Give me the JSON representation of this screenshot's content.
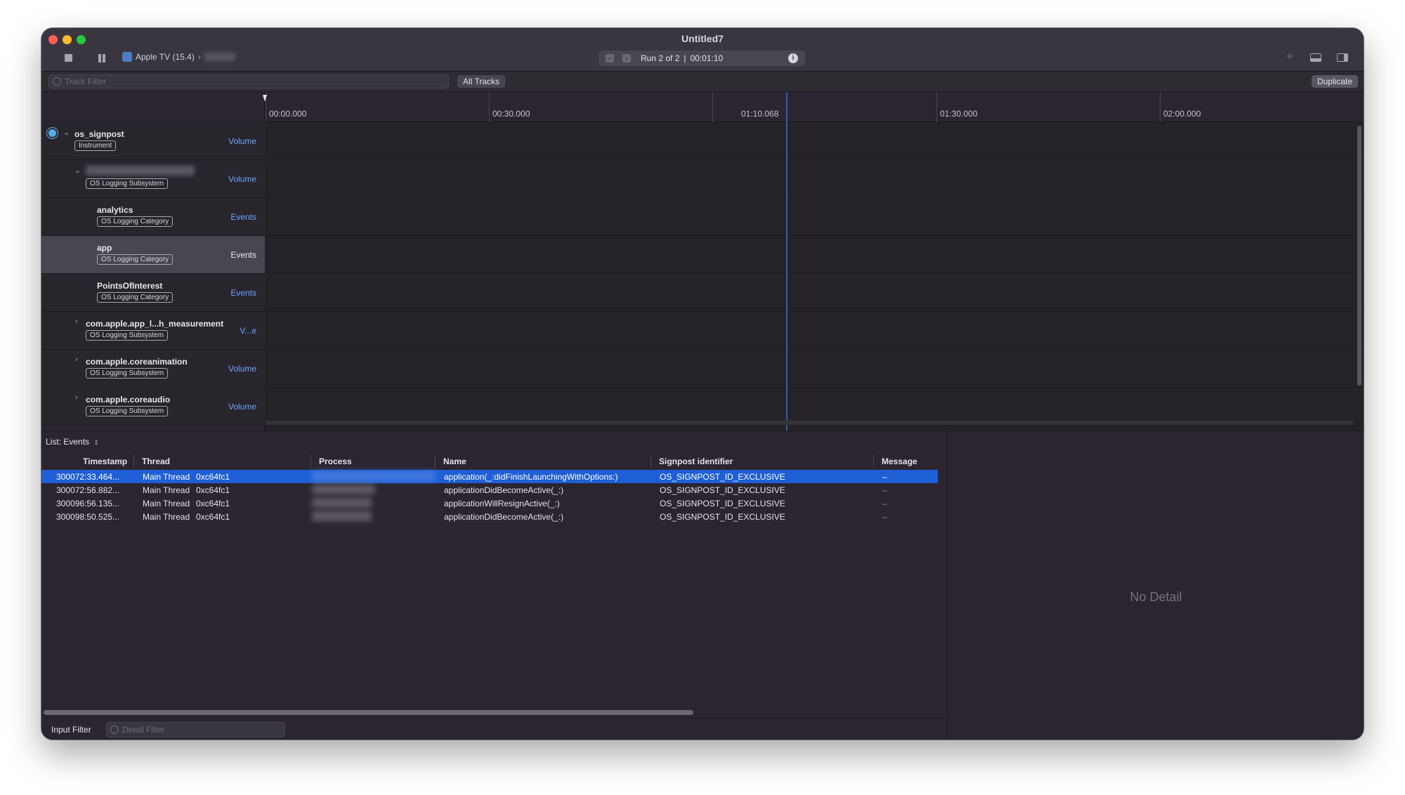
{
  "window": {
    "title": "Untitled7"
  },
  "toolbar": {
    "device": "Apple TV (15.4)",
    "run_label": "Run 2 of 2",
    "run_separator": "|",
    "run_time": "00:01:10",
    "info_glyph": "i",
    "plus_glyph": "+"
  },
  "filterbar": {
    "track_filter_placeholder": "Track Filter",
    "all_tracks": "All Tracks",
    "duplicate": "Duplicate"
  },
  "ruler": {
    "ticks": [
      "00:00.000",
      "00:30.000",
      "01:30.000",
      "02:00.000"
    ],
    "inspection_time": "01:10.068"
  },
  "tracks": [
    {
      "name": "os_signpost",
      "tag": "Instrument",
      "kind": "Volume",
      "expanded": true
    },
    {
      "name": "",
      "tag": "OS Logging Subsystem",
      "kind": "Volume",
      "expanded": true
    },
    {
      "name": "analytics",
      "tag": "OS Logging Category",
      "kind": "Events"
    },
    {
      "name": "app",
      "tag": "OS Logging Category",
      "kind": "Events",
      "selected": true
    },
    {
      "name": "PointsOfInterest",
      "tag": "OS Logging Category",
      "kind": "Events"
    },
    {
      "name": "com.apple.app_l...h_measurement",
      "tag": "OS Logging Subsystem",
      "kind": "V...e",
      "expanded": false
    },
    {
      "name": "com.apple.coreanimation",
      "tag": "OS Logging Subsystem",
      "kind": "Volume",
      "expanded": false
    },
    {
      "name": "com.apple.coreaudio",
      "tag": "OS Logging Subsystem",
      "kind": "Volume",
      "expanded": false
    }
  ],
  "list": {
    "mode_label": "List: Events",
    "columns": {
      "timestamp": "Timestamp",
      "thread": "Thread",
      "process": "Process",
      "name": "Name",
      "signpost_id": "Signpost identifier",
      "message": "Message"
    },
    "rows": [
      {
        "timestamp": "300072:33.464...",
        "thread": "Main Thread",
        "thread_id": "0xc64fc1",
        "name": "application(_:didFinishLaunchingWithOptions:)",
        "signpost_id": "OS_SIGNPOST_ID_EXCLUSIVE",
        "message": "–",
        "selected": true
      },
      {
        "timestamp": "300072:56.882...",
        "thread": "Main Thread",
        "thread_id": "0xc64fc1",
        "name": "applicationDidBecomeActive(_:)",
        "signpost_id": "OS_SIGNPOST_ID_EXCLUSIVE",
        "message": "–"
      },
      {
        "timestamp": "300096:56.135...",
        "thread": "Main Thread",
        "thread_id": "0xc64fc1",
        "name": "applicationWillResignActive(_:)",
        "signpost_id": "OS_SIGNPOST_ID_EXCLUSIVE",
        "message": "–"
      },
      {
        "timestamp": "300098:50.525...",
        "thread": "Main Thread",
        "thread_id": "0xc64fc1",
        "name": "applicationDidBecomeActive(_:)",
        "signpost_id": "OS_SIGNPOST_ID_EXCLUSIVE",
        "message": "–"
      }
    ],
    "input_filter": "Input Filter",
    "detail_filter_placeholder": "Detail Filter"
  },
  "detail": {
    "empty_text": "No Detail"
  },
  "colors": {
    "accent": "#1f5fd6",
    "link": "#6ba7ff",
    "background": "#2a2530"
  },
  "icons": [
    "close-icon",
    "minimize-icon",
    "zoom-icon",
    "stop-icon",
    "pause-icon",
    "appletv-icon",
    "chevron-right-icon",
    "info-icon",
    "plus-icon",
    "bottom-panel-icon",
    "right-panel-icon",
    "filter-icon",
    "disclosure-icon"
  ]
}
